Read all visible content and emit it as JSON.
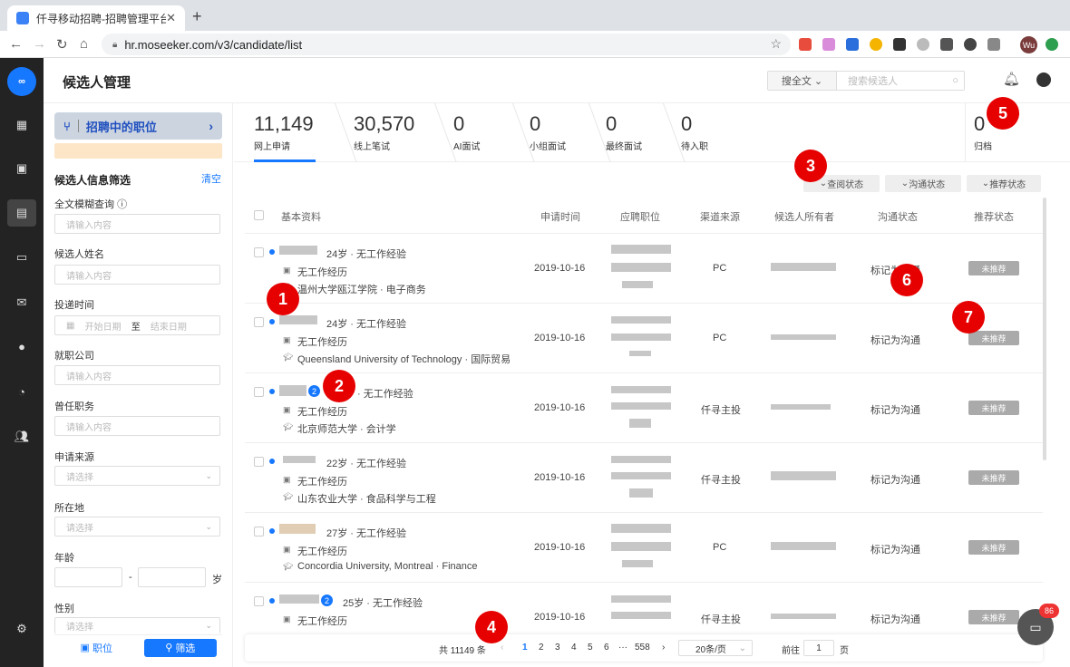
{
  "browser": {
    "tab_title": "仟寻移动招聘-招聘管理平台",
    "url": "hr.moseeker.com/v3/candidate/list",
    "profile_initials": "Wu"
  },
  "app": {
    "logo_text": "∞",
    "page_title": "候选人管理",
    "search_scope": "搜全文",
    "search_placeholder": "搜索候选人"
  },
  "filter": {
    "job_button": "招聘中的职位",
    "title": "候选人信息筛选",
    "clear": "清空",
    "fulltext_label": "全文模糊查询",
    "fulltext_placeholder": "请输入内容",
    "name_label": "候选人姓名",
    "name_placeholder": "请输入内容",
    "date_label": "投递时间",
    "date_start": "开始日期",
    "date_to": "至",
    "date_end": "结束日期",
    "company_label": "就职公司",
    "company_placeholder": "请输入内容",
    "position_label": "曾任职务",
    "position_placeholder": "请输入内容",
    "source_label": "申请来源",
    "source_placeholder": "请选择",
    "location_label": "所在地",
    "location_placeholder": "请选择",
    "age_label": "年龄",
    "age_dash": "-",
    "age_unit": "岁",
    "gender_label": "性别",
    "gender_placeholder": "请选择",
    "tab_position": "职位",
    "tab_filter": "筛选"
  },
  "stats": [
    {
      "num": "11,149",
      "label": "网上申请"
    },
    {
      "num": "30,570",
      "label": "线上笔试"
    },
    {
      "num": "0",
      "label": "AI面试"
    },
    {
      "num": "0",
      "label": "小组面试"
    },
    {
      "num": "0",
      "label": "最终面试"
    },
    {
      "num": "0",
      "label": "待入职"
    },
    {
      "num": "0",
      "label": "归档"
    }
  ],
  "status_filters": [
    "查阅状态",
    "沟通状态",
    "推荐状态"
  ],
  "table": {
    "headers": [
      "基本资料",
      "申请时间",
      "应聘职位",
      "渠道来源",
      "候选人所有者",
      "沟通状态",
      "推荐状态"
    ],
    "rows": [
      {
        "age": "24岁",
        "exp": "无工作经验",
        "work": "无工作经历",
        "school": "温州大学瓯江学院",
        "major": "电子商务",
        "date": "2019-10-16",
        "source": "PC",
        "comm": "标记为沟通",
        "rec": "未推荐"
      },
      {
        "age": "24岁",
        "exp": "无工作经验",
        "work": "无工作经历",
        "school": "Queensland University of Technology",
        "major": "国际贸易",
        "date": "2019-10-16",
        "source": "PC",
        "comm": "标记为沟通",
        "rec": "未推荐"
      },
      {
        "age": "",
        "exp": "无工作经验",
        "work": "无工作经历",
        "school": "北京师范大学",
        "major": "会计学",
        "date": "2019-10-16",
        "source": "仟寻主投",
        "comm": "标记为沟通",
        "rec": "未推荐",
        "badge": "2"
      },
      {
        "age": "22岁",
        "exp": "无工作经验",
        "work": "无工作经历",
        "school": "山东农业大学",
        "major": "食品科学与工程",
        "date": "2019-10-16",
        "source": "仟寻主投",
        "comm": "标记为沟通",
        "rec": "未推荐"
      },
      {
        "age": "27岁",
        "exp": "无工作经验",
        "work": "无工作经历",
        "school": "Concordia University, Montreal",
        "major": "Finance",
        "date": "2019-10-16",
        "source": "PC",
        "comm": "标记为沟通",
        "rec": "未推荐"
      },
      {
        "age": "25岁",
        "exp": "无工作经验",
        "work": "无工作经历",
        "school": "",
        "major": "",
        "date": "2019-10-16",
        "source": "仟寻主投",
        "comm": "标记为沟通",
        "rec": "未推荐",
        "badge": "2"
      }
    ]
  },
  "pager": {
    "total": "共 11149 条",
    "pages": [
      "1",
      "2",
      "3",
      "4",
      "5",
      "6",
      "···",
      "558"
    ],
    "page_size": "20条/页",
    "goto": "前往",
    "goto_value": "1",
    "page_unit": "页"
  },
  "chat_badge": "86",
  "markers": [
    "1",
    "2",
    "3",
    "4",
    "5",
    "6",
    "7"
  ],
  "colors": {
    "accent": "#1677ff",
    "marker": "#e60000",
    "sidebar": "#232323"
  }
}
